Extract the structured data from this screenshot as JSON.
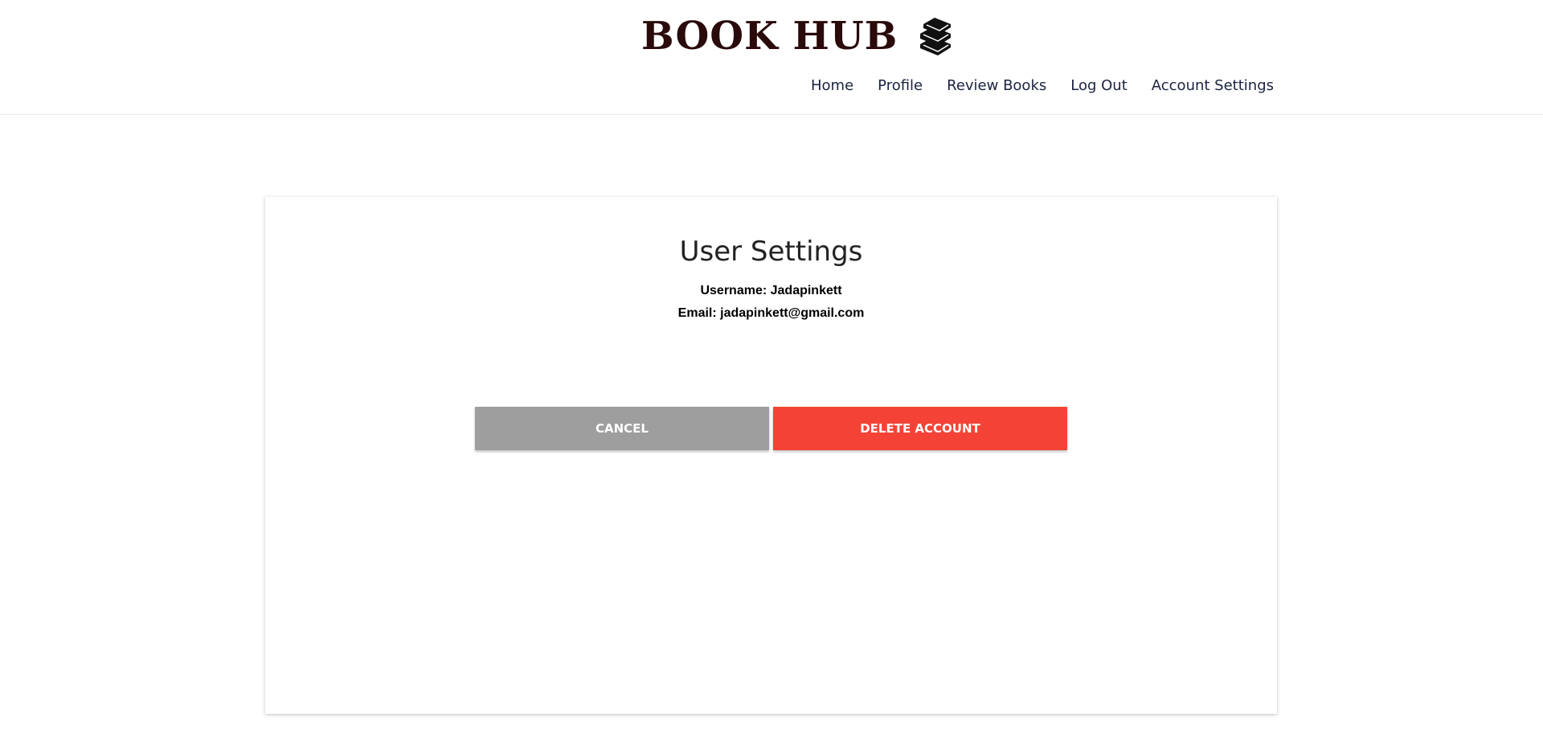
{
  "header": {
    "brand_title": "BOOK HUB",
    "brand_icon": "books-stack-icon",
    "nav": [
      {
        "label": "Home"
      },
      {
        "label": "Profile"
      },
      {
        "label": "Review Books"
      },
      {
        "label": "Log Out"
      },
      {
        "label": "Account Settings"
      }
    ]
  },
  "settings": {
    "title": "User Settings",
    "username_line": "Username: Jadapinkett",
    "email_line": "Email: jadapinkett@gmail.com",
    "cancel_label": "CANCEL",
    "delete_label": "DELETE ACCOUNT"
  },
  "colors": {
    "brand": "#2a0a0a",
    "nav_text": "#1a2340",
    "cancel_button": "#9e9e9e",
    "delete_button": "#f44336"
  }
}
